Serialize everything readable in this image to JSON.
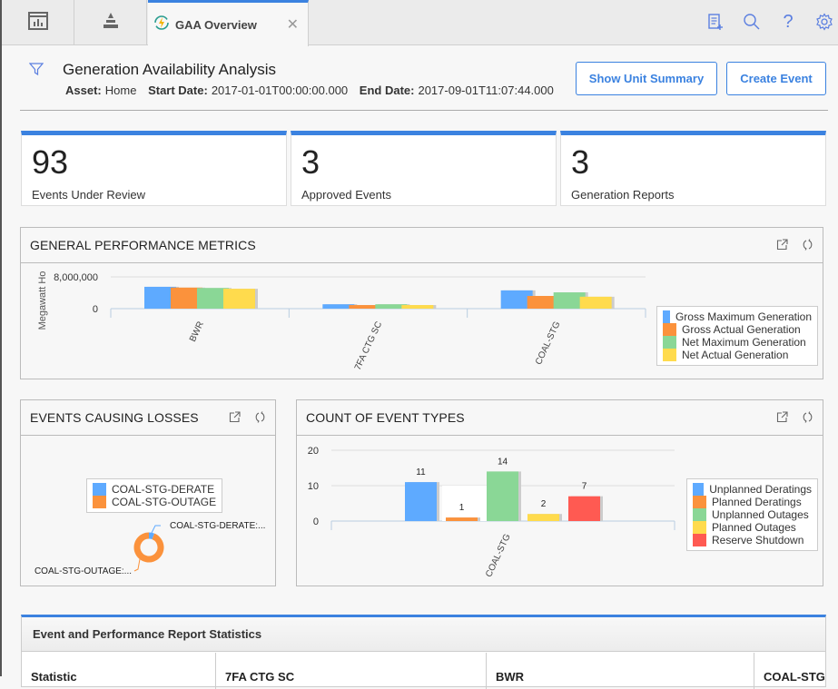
{
  "tabs": {
    "icon_tabs": [
      {
        "name": "dashboard-tab",
        "icon": "bar-chart-window-icon"
      },
      {
        "name": "hierarchy-tab",
        "icon": "pyramid-icon"
      }
    ],
    "active": {
      "label": "GAA Overview",
      "icon": "gaa-cycle-lightning-icon",
      "close_icon": "close-icon"
    }
  },
  "top_actions": [
    {
      "name": "new-record-icon"
    },
    {
      "name": "search-icon"
    },
    {
      "name": "help-icon"
    },
    {
      "name": "settings-gear-icon"
    }
  ],
  "header": {
    "title": "Generation Availability Analysis",
    "asset_label": "Asset:",
    "asset_value": "Home",
    "start_label": "Start Date:",
    "start_value": "2017-01-01T00:00:00.000",
    "end_label": "End Date:",
    "end_value": "2017-09-01T11:07:44.000",
    "show_unit_summary": "Show Unit Summary",
    "create_event": "Create Event"
  },
  "kpis": [
    {
      "value": "93",
      "label": "Events Under Review"
    },
    {
      "value": "3",
      "label": "Approved Events"
    },
    {
      "value": "3",
      "label": "Generation Reports"
    }
  ],
  "panels": {
    "performance": {
      "title": "GENERAL PERFORMANCE METRICS"
    },
    "losses": {
      "title": "EVENTS CAUSING LOSSES"
    },
    "event_types": {
      "title": "COUNT OF EVENT TYPES"
    }
  },
  "chart_data": [
    {
      "type": "bar",
      "title": "GENERAL PERFORMANCE METRICS",
      "ylabel": "Megawatt Ho",
      "xlabel": "",
      "categories": [
        "BWR",
        "7FA CTG SC",
        "COAL-STG"
      ],
      "ylim": [
        0,
        8000000
      ],
      "yticks": [
        0,
        8000000
      ],
      "ytick_labels": [
        "0",
        "8,000,000"
      ],
      "grid": true,
      "legend_position": "right",
      "series": [
        {
          "name": "Gross Maximum Generation",
          "color": "#5eaaff",
          "values": [
            5500000,
            1100000,
            4600000
          ]
        },
        {
          "name": "Gross Actual Generation",
          "color": "#fb923c",
          "values": [
            5300000,
            900000,
            3200000
          ]
        },
        {
          "name": "Net Maximum Generation",
          "color": "#8ad796",
          "values": [
            5200000,
            1100000,
            4100000
          ]
        },
        {
          "name": "Net Actual Generation",
          "color": "#ffdb4d",
          "values": [
            5000000,
            900000,
            3000000
          ]
        }
      ]
    },
    {
      "type": "pie",
      "title": "EVENTS CAUSING LOSSES",
      "donut": true,
      "legend_position": "top",
      "slices": [
        {
          "name": "COAL-STG-DERATE",
          "label": "COAL-STG-DERATE:...",
          "color": "#5eaaff",
          "value": 6
        },
        {
          "name": "COAL-STG-OUTAGE",
          "label": "COAL-STG-OUTAGE:...",
          "color": "#fb923c",
          "value": 94
        }
      ]
    },
    {
      "type": "bar",
      "title": "COUNT OF EVENT TYPES",
      "xlabel": "",
      "ylabel": "",
      "categories": [
        "COAL-STG"
      ],
      "ylim": [
        0,
        20
      ],
      "yticks": [
        0,
        10,
        20
      ],
      "ytick_labels": [
        "0",
        "10",
        "20"
      ],
      "grid": true,
      "legend_position": "right",
      "series": [
        {
          "name": "Unplanned Deratings",
          "color": "#5eaaff",
          "values": [
            11
          ]
        },
        {
          "name": "Planned Deratings",
          "color": "#fb923c",
          "values": [
            1
          ]
        },
        {
          "name": "Unplanned Outages",
          "color": "#8ad796",
          "values": [
            14
          ]
        },
        {
          "name": "Planned Outages",
          "color": "#ffdb4d",
          "values": [
            2
          ]
        },
        {
          "name": "Reserve Shutdown",
          "color": "#ff5a52",
          "values": [
            7
          ]
        }
      ]
    }
  ],
  "stats": {
    "title": "Event and Performance Report Statistics",
    "columns": [
      "Statistic",
      "7FA CTG SC",
      "BWR",
      "COAL-STG"
    ]
  },
  "colors": {
    "accent": "#3b82e0"
  }
}
